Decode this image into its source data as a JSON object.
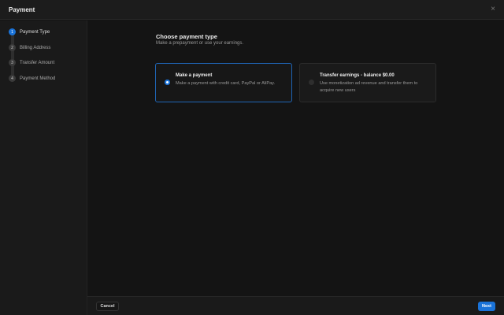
{
  "header": {
    "title": "Payment",
    "close_icon": "×"
  },
  "steps": [
    {
      "num": "1",
      "label": "Payment Type"
    },
    {
      "num": "2",
      "label": "Billing Address"
    },
    {
      "num": "3",
      "label": "Transfer Amount"
    },
    {
      "num": "4",
      "label": "Payment Method"
    }
  ],
  "main": {
    "heading": "Choose payment type",
    "subheading": "Make a prepayment or use your earnings.",
    "options": [
      {
        "title": "Make a payment",
        "desc": "Make a payment with credit card, PayPal or AliPay.",
        "selected": true
      },
      {
        "title": "Transfer earnings - balance $0.00",
        "desc": "Use monetization ad revenue and transfer them to acquire new users",
        "selected": false
      }
    ]
  },
  "footer": {
    "cancel": "Cancel",
    "next": "Next"
  },
  "colors": {
    "accent": "#1a73d9"
  }
}
